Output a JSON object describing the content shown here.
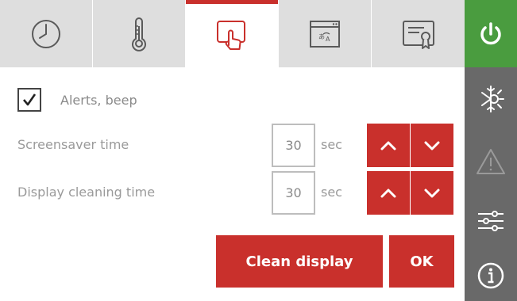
{
  "tabs": [
    {
      "icon": "clock-icon",
      "active": false
    },
    {
      "icon": "thermometer-icon",
      "active": false
    },
    {
      "icon": "touch-display-icon",
      "active": true
    },
    {
      "icon": "language-window-icon",
      "active": false
    },
    {
      "icon": "certificate-icon",
      "active": false
    }
  ],
  "sidebar": [
    {
      "icon": "power-icon"
    },
    {
      "icon": "defrost-icon"
    },
    {
      "icon": "warning-icon"
    },
    {
      "icon": "sliders-icon"
    },
    {
      "icon": "info-icon"
    }
  ],
  "alerts": {
    "label": "Alerts, beep",
    "checked": true
  },
  "screensaver": {
    "label": "Screensaver time",
    "value": "30",
    "unit": "sec"
  },
  "cleaning": {
    "label": "Display cleaning time",
    "value": "30",
    "unit": "sec"
  },
  "buttons": {
    "clean_display": "Clean display",
    "ok": "OK"
  },
  "colors": {
    "accent": "#c9302c",
    "power_green": "#4a9c3f",
    "sidebar": "#696969",
    "tab_bg": "#dedede"
  }
}
